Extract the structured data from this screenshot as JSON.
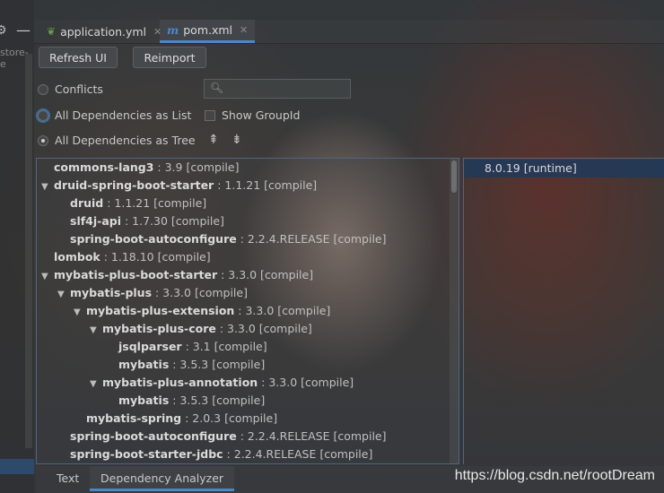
{
  "tabs": [
    {
      "label": "application.yml",
      "icon": "spring-leaf-icon"
    },
    {
      "label": "pom.xml",
      "icon": "maven-m-icon",
      "active": true
    }
  ],
  "sidebar": {
    "project_label": "store-e"
  },
  "toolbar": {
    "refresh_label": "Refresh UI",
    "reimport_label": "Reimport"
  },
  "options": {
    "conflicts_label": "Conflicts",
    "list_label": "All Dependencies as List",
    "tree_label": "All Dependencies as Tree",
    "show_groupid_label": "Show GroupId",
    "selected_mode": "tree"
  },
  "search": {
    "placeholder": ""
  },
  "tree": [
    {
      "name": "commons-lang3",
      "version": ": 3.9 [compile]",
      "level": 0,
      "expanded": null
    },
    {
      "name": "druid-spring-boot-starter",
      "version": ": 1.1.21 [compile]",
      "level": 0,
      "expanded": true
    },
    {
      "name": "druid",
      "version": ": 1.1.21 [compile]",
      "level": 1,
      "expanded": null
    },
    {
      "name": "slf4j-api",
      "version": ": 1.7.30 [compile]",
      "level": 1,
      "expanded": null
    },
    {
      "name": "spring-boot-autoconfigure",
      "version": ": 2.2.4.RELEASE [compile]",
      "level": 1,
      "expanded": null
    },
    {
      "name": "lombok",
      "version": ": 1.18.10 [compile]",
      "level": 0,
      "expanded": null
    },
    {
      "name": "mybatis-plus-boot-starter",
      "version": ": 3.3.0 [compile]",
      "level": 0,
      "expanded": true
    },
    {
      "name": "mybatis-plus",
      "version": ": 3.3.0 [compile]",
      "level": 1,
      "expanded": true
    },
    {
      "name": "mybatis-plus-extension",
      "version": ": 3.3.0 [compile]",
      "level": 2,
      "expanded": true
    },
    {
      "name": "mybatis-plus-core",
      "version": ": 3.3.0 [compile]",
      "level": 3,
      "expanded": true
    },
    {
      "name": "jsqlparser",
      "version": ": 3.1 [compile]",
      "level": 4,
      "expanded": null
    },
    {
      "name": "mybatis",
      "version": ": 3.5.3 [compile]",
      "level": 4,
      "expanded": null
    },
    {
      "name": "mybatis-plus-annotation",
      "version": ": 3.3.0 [compile]",
      "level": 3,
      "expanded": true
    },
    {
      "name": "mybatis",
      "version": ": 3.5.3 [compile]",
      "level": 4,
      "expanded": null
    },
    {
      "name": "mybatis-spring",
      "version": ": 2.0.3 [compile]",
      "level": 2,
      "expanded": null
    },
    {
      "name": "spring-boot-autoconfigure",
      "version": ": 2.2.4.RELEASE [compile]",
      "level": 1,
      "expanded": null
    },
    {
      "name": "spring-boot-starter-jdbc",
      "version": ": 2.2.4.RELEASE [compile]",
      "level": 1,
      "expanded": null
    }
  ],
  "detail": {
    "selected": "8.0.19 [runtime]"
  },
  "bottom_tabs": {
    "text_label": "Text",
    "analyzer_label": "Dependency Analyzer"
  },
  "watermark": "https://blog.csdn.net/rootDream",
  "colors": {
    "accent": "#4a88c7",
    "selection": "#203a5a",
    "border": "#4d6782"
  }
}
